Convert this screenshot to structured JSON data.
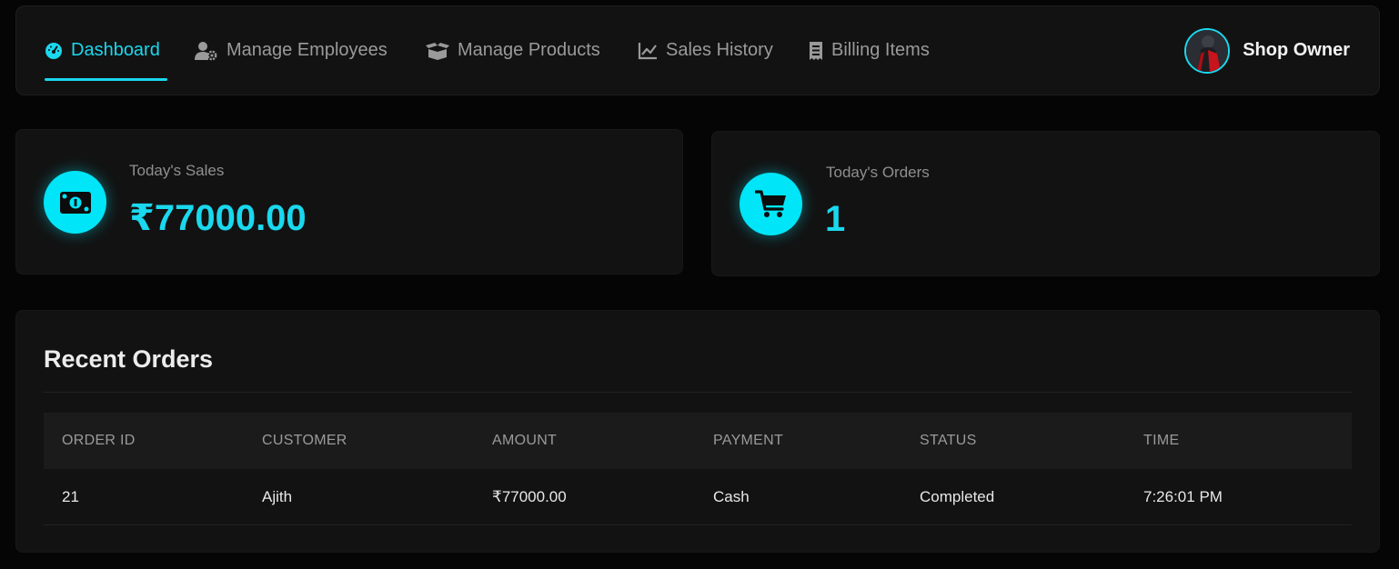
{
  "nav": {
    "items": [
      {
        "label": "Dashboard",
        "icon": "gauge-icon",
        "active": true
      },
      {
        "label": "Manage Employees",
        "icon": "user-gear-icon",
        "active": false
      },
      {
        "label": "Manage Products",
        "icon": "box-open-icon",
        "active": false
      },
      {
        "label": "Sales History",
        "icon": "line-chart-icon",
        "active": false
      },
      {
        "label": "Billing Items",
        "icon": "receipt-icon",
        "active": false
      }
    ],
    "user_name": "Shop Owner"
  },
  "stats": {
    "sales": {
      "label": "Today's Sales",
      "value": "₹77000.00",
      "icon": "money-bill-icon"
    },
    "orders": {
      "label": "Today's Orders",
      "value": "1",
      "icon": "shopping-cart-icon"
    }
  },
  "recent_orders": {
    "title": "Recent Orders",
    "headers": [
      "Order ID",
      "Customer",
      "Amount",
      "Payment",
      "Status",
      "Time"
    ],
    "rows": [
      [
        "21",
        "Ajith",
        "₹77000.00",
        "Cash",
        "Completed",
        "7:26:01 PM"
      ]
    ]
  },
  "colors": {
    "accent": "#1ad8ee",
    "background": "#050505",
    "card": "#121212"
  }
}
